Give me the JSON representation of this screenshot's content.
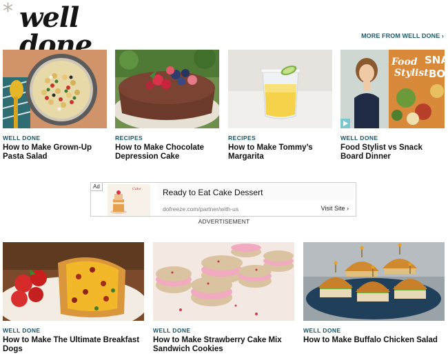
{
  "header": {
    "logo_star": "*",
    "logo_text": "well done",
    "more_link": "MORE FROM WELL DONE ›"
  },
  "row1": [
    {
      "category": "WELL DONE",
      "title": "How to Make Grown-Up Pasta Salad",
      "image": "pasta-salad-photo"
    },
    {
      "category": "RECIPES",
      "title": "How to Make Chocolate Depression Cake",
      "image": "chocolate-cake-photo"
    },
    {
      "category": "RECIPES",
      "title": "How to Make Tommy’s Margarita",
      "image": "margarita-photo"
    },
    {
      "category": "WELL DONE",
      "title": "Food Stylist vs Snack Board Dinner",
      "image": "food-stylist-video-thumbnail",
      "overlay_text": [
        "Food",
        "Stylist",
        "SNA",
        "BO"
      ]
    }
  ],
  "ad": {
    "tag": "Ad",
    "close": "✕",
    "headline": "Ready to Eat Cake Dessert",
    "url": "dofreeze.com/partner/with-us",
    "button": "Visit Site ›",
    "label": "ADVERTISEMENT",
    "brand": "Cake"
  },
  "row2": [
    {
      "category": "WELL DONE",
      "title": "How to Make The Ultimate Breakfast Dogs",
      "image": "breakfast-dogs-photo"
    },
    {
      "category": "WELL DONE",
      "title": "How to Make Strawberry Cake Mix Sandwich Cookies",
      "image": "sandwich-cookies-photo"
    },
    {
      "category": "WELL DONE",
      "title": "How to Make Buffalo Chicken Salad",
      "image": "buffalo-chicken-sliders-photo"
    }
  ],
  "colors": {
    "category": "#14546a",
    "link": "#1f5c6e",
    "ad_link": "#3b8bd6"
  }
}
